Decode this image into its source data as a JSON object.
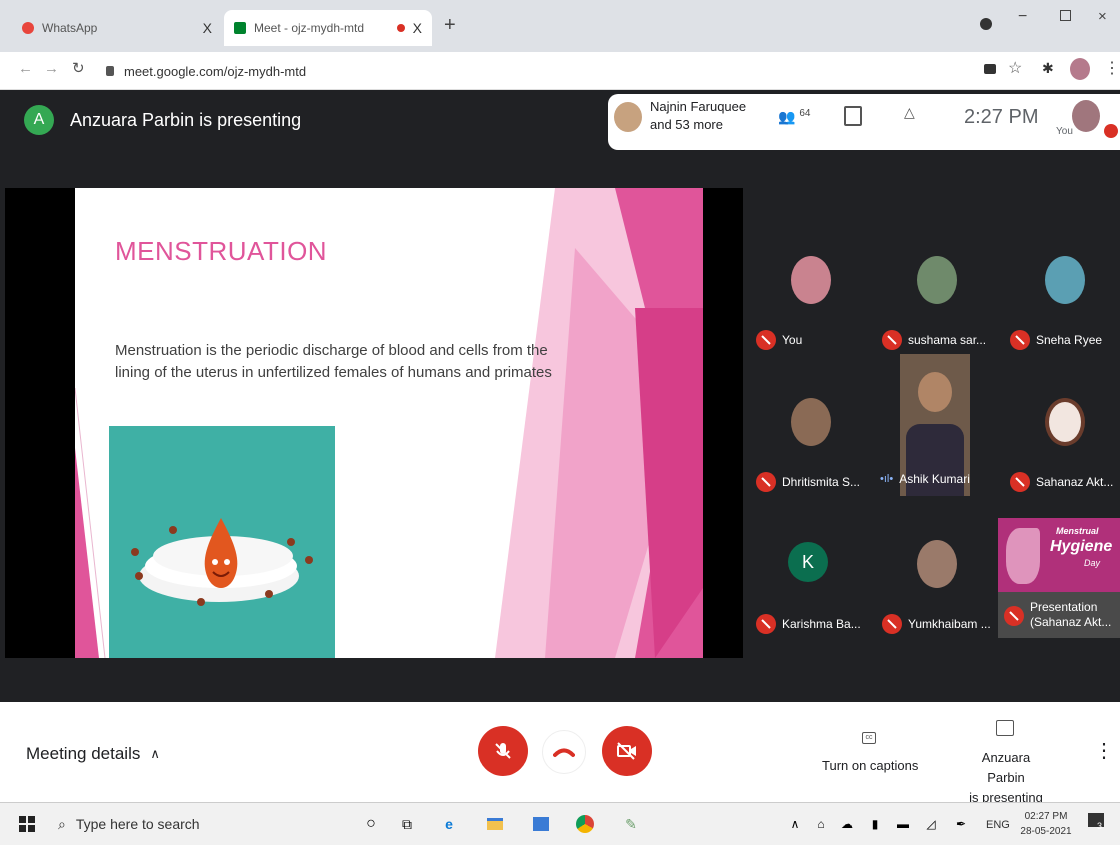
{
  "browser": {
    "tabs": [
      {
        "title": "WhatsApp",
        "close": "X"
      },
      {
        "title": "Meet - ojz-mydh-mtd",
        "close": "X"
      }
    ],
    "new_tab": "+",
    "url": "meet.google.com/ojz-mydh-mtd"
  },
  "meet": {
    "presenter_initial": "A",
    "presenter_text": "Anzuara Parbin is presenting",
    "participants_summary_name": "Najnin Faruquee",
    "participants_summary_more": "and 53 more",
    "people_count": "64",
    "time": "2:27 PM",
    "self_label": "You"
  },
  "slide": {
    "title": "MENSTRUATION",
    "body": "Menstruation is the periodic discharge of blood and cells from the lining of the uterus in unfertilized females of humans and primates"
  },
  "participants": [
    {
      "name": "You",
      "muted": true
    },
    {
      "name": "sushama sar...",
      "muted": true
    },
    {
      "name": "Sneha Ryee",
      "muted": true
    },
    {
      "name": "Dhritismita S...",
      "muted": true
    },
    {
      "name": "Ashik Kumari",
      "muted": false
    },
    {
      "name": "Sahanaz Akt...",
      "muted": true
    },
    {
      "name": "Karishma Ba...",
      "muted": true,
      "initial": "K"
    },
    {
      "name": "Yumkhaibam ...",
      "muted": true
    },
    {
      "name": "Presentation\n(Sahanaz Akt...",
      "muted": true
    }
  ],
  "presentation_thumb": {
    "line1": "Menstrual",
    "line2": "Hygiene",
    "line3": "Day",
    "caption1": "Presentation",
    "caption2": "(Sahanaz Akt..."
  },
  "controls": {
    "meeting_details": "Meeting details",
    "captions_label": "Turn on captions",
    "presenting_line1": "Anzuara Parbin",
    "presenting_line2": "is presenting",
    "more": "⋮"
  },
  "taskbar": {
    "search_placeholder": "Type here to search",
    "lang": "ENG",
    "clock_time": "02:27 PM",
    "clock_date": "28-05-2021",
    "notif_count": "3"
  },
  "colors": {
    "meet_bg": "#202124",
    "mute_red": "#d93025",
    "slide_pink": "#e0559a",
    "presenter_green": "#34a853"
  }
}
